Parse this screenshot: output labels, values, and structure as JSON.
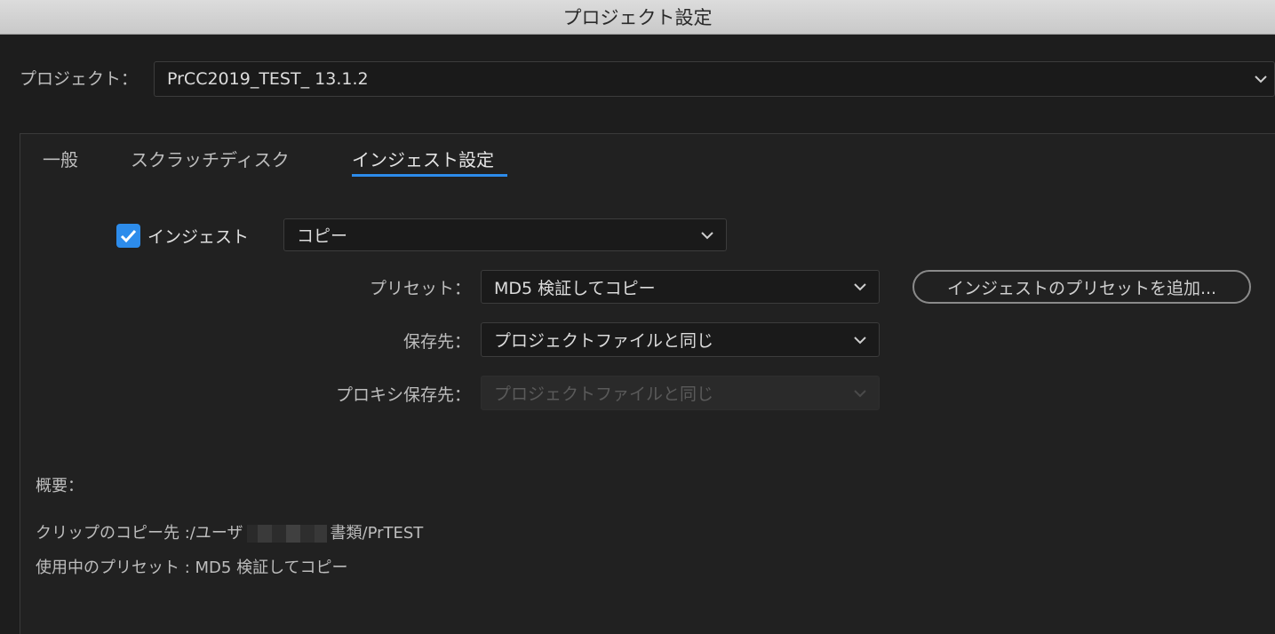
{
  "window": {
    "title": "プロジェクト設定"
  },
  "project": {
    "label": "プロジェクト：",
    "value": "PrCC2019_TEST_ 13.1.2"
  },
  "tabs": [
    {
      "label": "一般"
    },
    {
      "label": "スクラッチディスク"
    },
    {
      "label": "インジェスト設定"
    }
  ],
  "ingest": {
    "checkbox_label": "インジェスト",
    "checked": true,
    "mode_value": "コピー"
  },
  "preset": {
    "label": "プリセット：",
    "value": "MD5 検証してコピー",
    "add_button": "インジェストのプリセットを追加..."
  },
  "destination": {
    "label": "保存先：",
    "value": "プロジェクトファイルと同じ"
  },
  "proxy_destination": {
    "label": "プロキシ保存先：",
    "value": "プロジェクトファイルと同じ"
  },
  "summary": {
    "heading": "概要：",
    "copy_dest_prefix": "クリップのコピー先 :/ユーザ",
    "copy_dest_suffix": "書類/PrTEST",
    "preset_in_use": "使用中のプリセット : MD5 検証してコピー"
  },
  "colors": {
    "accent": "#2d8ceb",
    "background": "#212121",
    "titlebar": "#d4d4d4"
  }
}
